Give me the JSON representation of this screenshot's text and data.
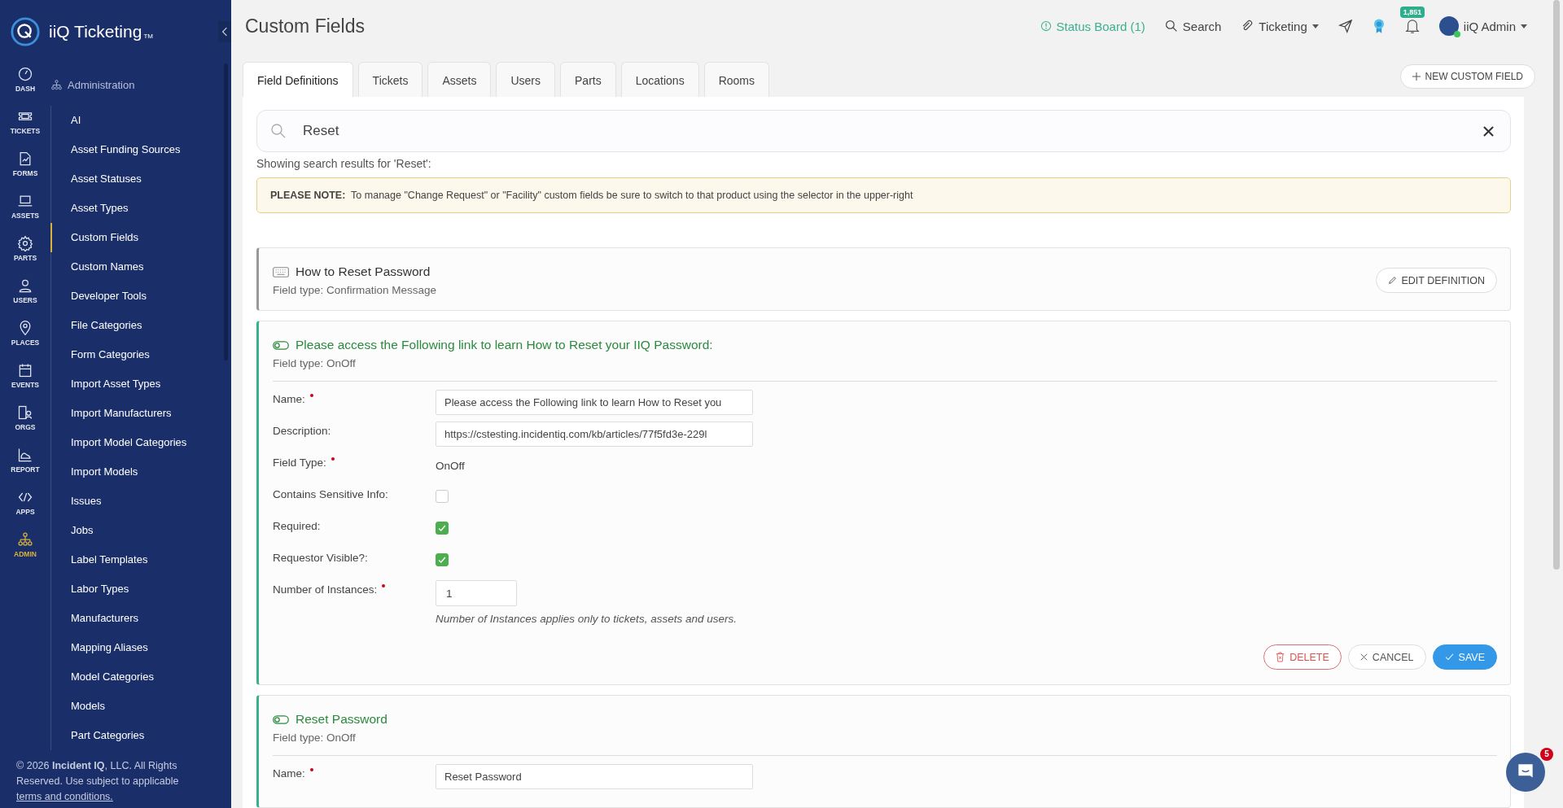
{
  "app": {
    "name": "iiQ Ticketing",
    "trademark": "TM"
  },
  "rail": [
    {
      "label": "DASH",
      "selected": false
    },
    {
      "label": "TICKETS",
      "selected": false
    },
    {
      "label": "FORMS",
      "selected": false
    },
    {
      "label": "ASSETS",
      "selected": false
    },
    {
      "label": "PARTS",
      "selected": false
    },
    {
      "label": "USERS",
      "selected": false
    },
    {
      "label": "PLACES",
      "selected": false
    },
    {
      "label": "EVENTS",
      "selected": false
    },
    {
      "label": "ORGS",
      "selected": false
    },
    {
      "label": "REPORT",
      "selected": false
    },
    {
      "label": "APPS",
      "selected": false
    },
    {
      "label": "ADMIN",
      "selected": true
    }
  ],
  "section": "Administration",
  "admin_menu": [
    {
      "label": "AI",
      "selected": false
    },
    {
      "label": "Asset Funding Sources",
      "selected": false
    },
    {
      "label": "Asset Statuses",
      "selected": false
    },
    {
      "label": "Asset Types",
      "selected": false
    },
    {
      "label": "Custom Fields",
      "selected": true
    },
    {
      "label": "Custom Names",
      "selected": false
    },
    {
      "label": "Developer Tools",
      "selected": false
    },
    {
      "label": "File Categories",
      "selected": false
    },
    {
      "label": "Form Categories",
      "selected": false
    },
    {
      "label": "Import Asset Types",
      "selected": false
    },
    {
      "label": "Import Manufacturers",
      "selected": false
    },
    {
      "label": "Import Model Categories",
      "selected": false
    },
    {
      "label": "Import Models",
      "selected": false
    },
    {
      "label": "Issues",
      "selected": false
    },
    {
      "label": "Jobs",
      "selected": false
    },
    {
      "label": "Label Templates",
      "selected": false
    },
    {
      "label": "Labor Types",
      "selected": false
    },
    {
      "label": "Manufacturers",
      "selected": false
    },
    {
      "label": "Mapping Aliases",
      "selected": false
    },
    {
      "label": "Model Categories",
      "selected": false
    },
    {
      "label": "Models",
      "selected": false
    },
    {
      "label": "Part Categories",
      "selected": false
    }
  ],
  "footer": {
    "text": "© 2026 **Incident IQ**, LLC. All Rights Reserved. Use subject to applicable",
    "link": "terms and conditions."
  },
  "page_title": "Custom Fields",
  "header": {
    "status_board": "Status Board (1)",
    "search": "Search",
    "product": "Ticketing",
    "notifications": "1,851",
    "user": "iiQ Admin"
  },
  "new_button": "NEW CUSTOM FIELD",
  "tabs": [
    {
      "label": "Field Definitions",
      "selected": true
    },
    {
      "label": "Tickets",
      "selected": false
    },
    {
      "label": "Assets",
      "selected": false
    },
    {
      "label": "Users",
      "selected": false
    },
    {
      "label": "Parts",
      "selected": false
    },
    {
      "label": "Locations",
      "selected": false
    },
    {
      "label": "Rooms",
      "selected": false
    }
  ],
  "search": {
    "value": "Reset"
  },
  "results_text": "Showing search results for 'Reset':",
  "note": "**PLEASE NOTE:**  To manage \"Change Request\" or \"Facility\" custom fields be sure to switch to that product using the selector in the upper-right",
  "fields": [
    {
      "kind": "collapsed",
      "title": "How to Reset Password",
      "type": "Field type: Confirmation Message",
      "edit": "EDIT DEFINITION"
    },
    {
      "kind": "expanded",
      "title": "Please access the Following link to learn How to Reset your IIQ Password:",
      "type": "Field type: OnOff",
      "rows": [
        {
          "kind": "input",
          "label": "Name:",
          "required": true,
          "value": "Please access the Following link to learn How to Reset you"
        },
        {
          "kind": "input",
          "label": "Description:",
          "required": false,
          "value": "https://cstesting.incidentiq.com/kb/articles/77f5fd3e-229l"
        },
        {
          "kind": "static",
          "label": "Field Type:",
          "required": true,
          "value": "OnOff"
        },
        {
          "kind": "checkbox",
          "label": "Contains Sensitive Info:",
          "required": false,
          "checked": false
        },
        {
          "kind": "checkbox",
          "label": "Required:",
          "required": false,
          "checked": true
        },
        {
          "kind": "checkbox",
          "label": "Requestor Visible?:",
          "required": false,
          "checked": true
        },
        {
          "kind": "number",
          "label": "Number of Instances:",
          "required": true,
          "value": "1",
          "hint": "Number of Instances applies only to tickets, assets and users."
        }
      ],
      "buttons": [
        {
          "kind": "delete",
          "label": "DELETE"
        },
        {
          "kind": "cancel",
          "label": "CANCEL"
        },
        {
          "kind": "save",
          "label": "SAVE"
        }
      ]
    },
    {
      "kind": "expanded",
      "title": "Reset Password",
      "type": "Field type: OnOff",
      "rows": [
        {
          "kind": "input",
          "label": "Name:",
          "required": true,
          "value": "Reset Password"
        }
      ]
    }
  ],
  "chat": {
    "badge": "5"
  }
}
